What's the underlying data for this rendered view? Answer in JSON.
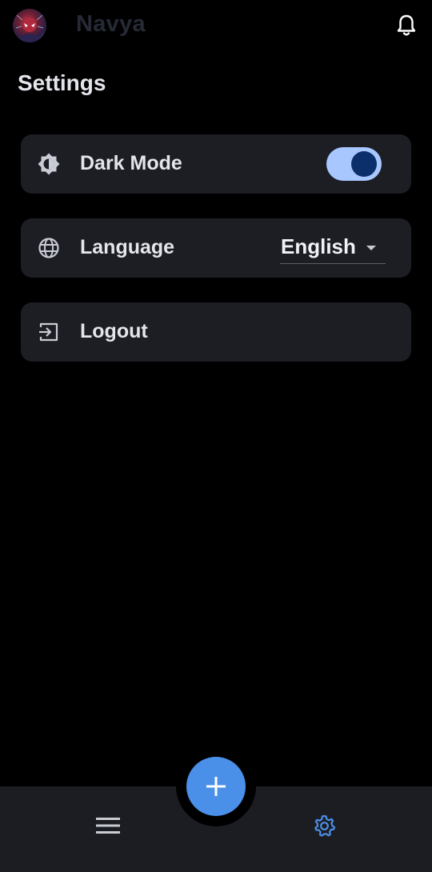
{
  "header": {
    "user_name": "Navya",
    "avatar_icon": "avatar-image",
    "notification_icon": "bell-icon"
  },
  "page": {
    "title": "Settings"
  },
  "settings": {
    "dark_mode": {
      "label": "Dark Mode",
      "icon": "brightness-icon",
      "enabled": true
    },
    "language": {
      "label": "Language",
      "icon": "globe-icon",
      "selected": "English"
    },
    "logout": {
      "label": "Logout",
      "icon": "logout-icon"
    }
  },
  "bottom_nav": {
    "menu_icon": "menu-icon",
    "add_icon": "plus-icon",
    "settings_icon": "gear-icon"
  },
  "colors": {
    "background": "#000000",
    "card": "#1c1e24",
    "accent": "#4a8fe8",
    "toggle_track": "#a9c7ff",
    "toggle_knob": "#0a2f6b"
  }
}
